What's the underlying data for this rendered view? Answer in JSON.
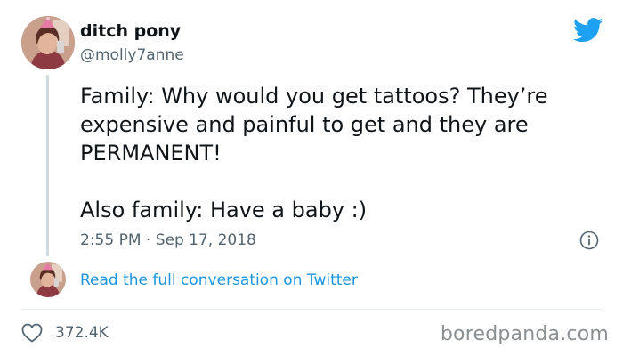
{
  "author": {
    "display_name": "ditch pony",
    "username": "@molly7anne"
  },
  "tweet": {
    "lines": [
      "Family: Why would you get tattoos? They’re expensive and painful to get and they are PERMANENT!",
      "Also family: Have a baby :)"
    ],
    "timestamp": "2:55 PM · Sep 17, 2018"
  },
  "conversation_link": "Read the full conversation on Twitter",
  "likes": "372.4K",
  "watermark": "boredpanda.com",
  "colors": {
    "twitter_blue": "#1da1f2",
    "link_blue": "#1b95e0",
    "secondary_text": "#536471"
  },
  "icons": [
    "twitter-bird-icon",
    "info-icon",
    "heart-icon"
  ]
}
